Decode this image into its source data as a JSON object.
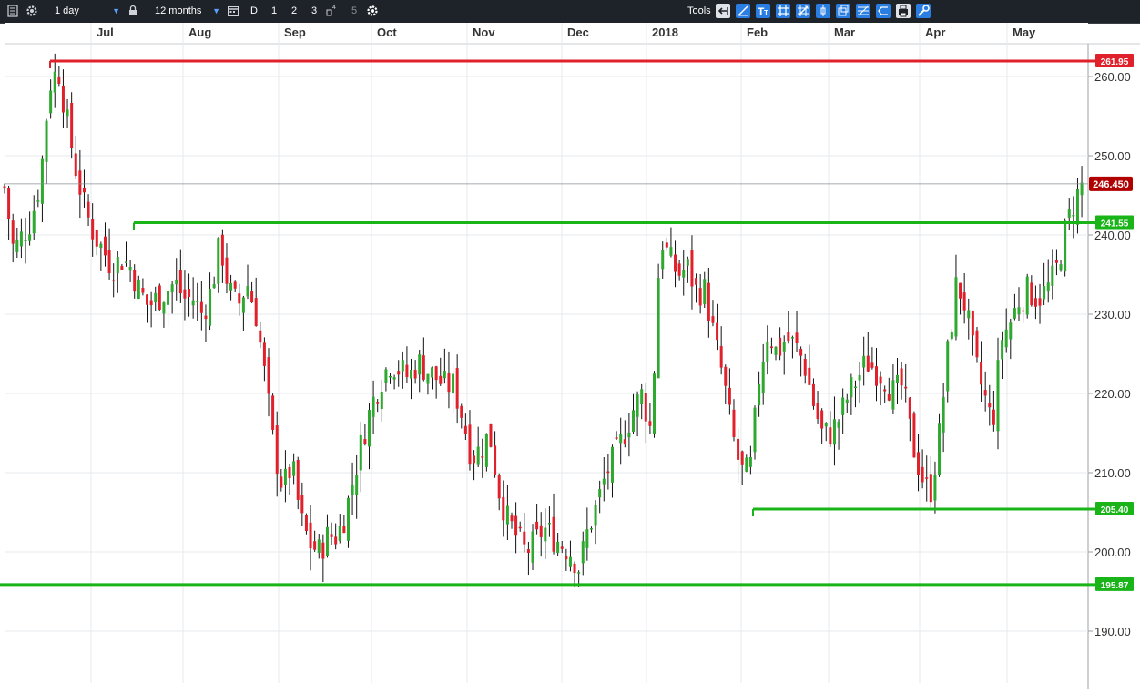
{
  "toolbar": {
    "interval": "1 day",
    "range": "12 months",
    "period_buttons": [
      "D",
      "1",
      "2",
      "3",
      "5"
    ],
    "tools_label": "Tools",
    "icons": [
      "list-icon",
      "gear-icon",
      "lock-icon",
      "calendar-icon",
      "settings-icon",
      "back-arrow-icon",
      "trendline-icon",
      "text-tool-icon",
      "grid-icon",
      "crosshair-icon",
      "candle-icon",
      "window-icon",
      "fibonacci-icon",
      "eraser-icon",
      "print-icon",
      "toolbox-icon"
    ]
  },
  "colors": {
    "up": "#2ea82e",
    "down": "#e0202a",
    "resistance": "#e0202a",
    "support": "#18b418",
    "grid": "#e6e8eb",
    "current": "#b00000"
  },
  "chart_data": {
    "type": "candlestick",
    "title": "",
    "xlabel": "",
    "ylabel": "",
    "x_tick_labels": [
      "Jul",
      "Aug",
      "Sep",
      "Oct",
      "Nov",
      "Dec",
      "2018",
      "Feb",
      "Mar",
      "Apr",
      "May"
    ],
    "y_ticks": [
      190,
      200,
      210,
      220,
      230,
      240,
      250,
      260
    ],
    "y_tick_labels": [
      "190.00",
      "200.00",
      "210.00",
      "220.00",
      "230.00",
      "240.00",
      "250.00",
      "260.00"
    ],
    "ylim": [
      186,
      265
    ],
    "grid": true,
    "current_price": {
      "value": 246.45,
      "label": "246.450"
    },
    "horizontal_lines": [
      {
        "value": 261.95,
        "label": "261.95",
        "color": "resistance",
        "start": "late Jun"
      },
      {
        "value": 241.55,
        "label": "241.55",
        "color": "support",
        "start": "early Jul"
      },
      {
        "value": 205.4,
        "label": "205.40",
        "color": "support",
        "start": "late Jan"
      },
      {
        "value": 195.87,
        "label": "195.87",
        "color": "support",
        "start": "early Jun"
      }
    ],
    "close_path": [
      [
        0,
        246
      ],
      [
        3,
        238
      ],
      [
        6,
        240
      ],
      [
        9,
        242
      ],
      [
        12,
        247
      ],
      [
        15,
        259
      ],
      [
        18,
        261
      ],
      [
        21,
        254
      ],
      [
        24,
        248
      ],
      [
        27,
        243
      ],
      [
        30,
        240
      ],
      [
        33,
        238
      ],
      [
        36,
        236
      ],
      [
        39,
        237
      ],
      [
        42,
        236
      ],
      [
        45,
        233
      ],
      [
        48,
        231
      ],
      [
        51,
        232
      ],
      [
        54,
        233
      ],
      [
        57,
        234
      ],
      [
        60,
        232
      ],
      [
        63,
        232
      ],
      [
        66,
        230
      ],
      [
        69,
        233
      ],
      [
        72,
        239
      ],
      [
        75,
        233
      ],
      [
        78,
        231
      ],
      [
        81,
        234
      ],
      [
        84,
        230
      ],
      [
        87,
        222
      ],
      [
        90,
        213
      ],
      [
        93,
        208
      ],
      [
        96,
        211
      ],
      [
        99,
        204
      ],
      [
        102,
        201
      ],
      [
        105,
        200
      ],
      [
        108,
        202
      ],
      [
        111,
        202
      ],
      [
        114,
        205
      ],
      [
        117,
        210
      ],
      [
        120,
        215
      ],
      [
        123,
        219
      ],
      [
        126,
        222
      ],
      [
        129,
        224
      ],
      [
        132,
        223
      ],
      [
        135,
        222
      ],
      [
        138,
        224
      ],
      [
        141,
        223
      ],
      [
        144,
        222
      ],
      [
        147,
        221
      ],
      [
        150,
        221
      ],
      [
        153,
        217
      ],
      [
        156,
        212
      ],
      [
        159,
        213
      ],
      [
        162,
        215
      ],
      [
        165,
        208
      ],
      [
        168,
        204
      ],
      [
        171,
        202
      ],
      [
        174,
        200
      ],
      [
        177,
        201
      ],
      [
        180,
        203
      ],
      [
        183,
        202
      ],
      [
        186,
        201
      ],
      [
        189,
        200
      ],
      [
        192,
        198
      ],
      [
        195,
        203
      ],
      [
        198,
        206
      ],
      [
        201,
        210
      ],
      [
        204,
        212
      ],
      [
        207,
        215
      ],
      [
        210,
        218
      ],
      [
        213,
        220
      ],
      [
        216,
        215
      ],
      [
        219,
        240
      ],
      [
        222,
        237
      ],
      [
        225,
        235
      ],
      [
        228,
        236
      ],
      [
        231,
        233
      ],
      [
        234,
        233
      ],
      [
        237,
        227
      ],
      [
        240,
        222
      ],
      [
        243,
        215
      ],
      [
        246,
        210
      ],
      [
        249,
        210
      ],
      [
        252,
        222
      ],
      [
        255,
        228
      ],
      [
        258,
        225
      ],
      [
        261,
        227
      ],
      [
        264,
        226
      ],
      [
        267,
        224
      ],
      [
        270,
        219
      ],
      [
        273,
        215
      ],
      [
        276,
        215
      ],
      [
        279,
        217
      ],
      [
        282,
        220
      ],
      [
        285,
        222
      ],
      [
        288,
        224
      ],
      [
        291,
        223
      ],
      [
        294,
        222
      ],
      [
        297,
        220
      ],
      [
        300,
        221
      ],
      [
        303,
        214
      ],
      [
        306,
        210
      ],
      [
        309,
        207
      ],
      [
        312,
        214
      ],
      [
        315,
        225
      ],
      [
        318,
        234
      ],
      [
        321,
        231
      ],
      [
        324,
        224
      ],
      [
        327,
        220
      ],
      [
        330,
        216
      ],
      [
        333,
        227
      ],
      [
        336,
        229
      ],
      [
        339,
        232
      ],
      [
        342,
        233
      ],
      [
        345,
        232
      ],
      [
        348,
        233
      ],
      [
        351,
        235
      ],
      [
        354,
        240
      ],
      [
        357,
        244
      ],
      [
        360,
        246.45
      ]
    ]
  }
}
